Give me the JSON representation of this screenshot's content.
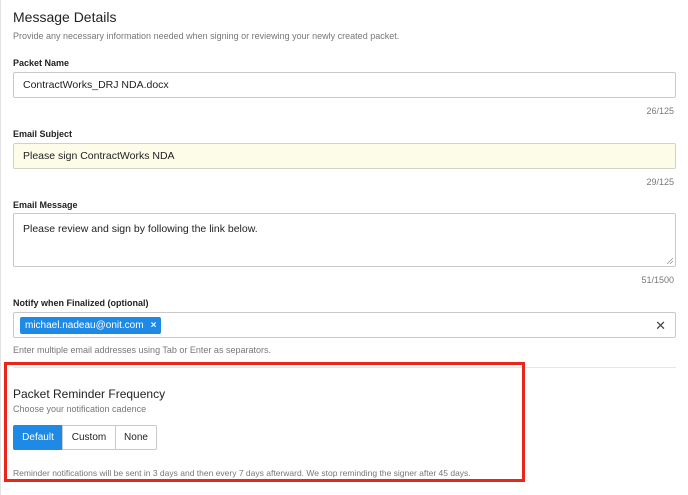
{
  "header": {
    "title": "Message Details",
    "subtitle": "Provide any necessary information needed when signing or reviewing your newly created packet."
  },
  "packet_name": {
    "label": "Packet Name",
    "value": "ContractWorks_DRJ NDA.docx",
    "counter": "26/125"
  },
  "email_subject": {
    "label": "Email Subject",
    "value": "Please sign ContractWorks NDA",
    "counter": "29/125"
  },
  "email_message": {
    "label": "Email Message",
    "value": "Please review and sign by following the link below.",
    "counter": "51/1500"
  },
  "notify": {
    "label": "Notify when Finalized (optional)",
    "tags": [
      "michael.nadeau@onit.com"
    ],
    "tag_remove_glyph": "×",
    "clear_glyph": "✕",
    "help": "Enter multiple email addresses using Tab or Enter as separators."
  },
  "reminder": {
    "title": "Packet Reminder Frequency",
    "subtitle": "Choose your notification cadence",
    "options": [
      "Default",
      "Custom",
      "None"
    ],
    "selected": "Default",
    "note": "Reminder notifications will be sent in 3 days and then every 7 days afterward. We stop reminding the signer after 45 days."
  },
  "colors": {
    "accent": "#1e8ae6",
    "highlight_box": "#e8261c",
    "subject_background": "#fcfce9"
  }
}
